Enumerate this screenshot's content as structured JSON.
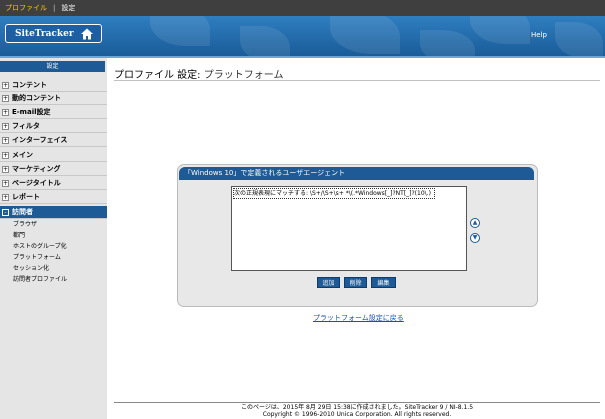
{
  "topnav": {
    "profile": "プロファイル",
    "settings": "設定",
    "separator": "|"
  },
  "header": {
    "logo": "SiteTracker",
    "help": "Help"
  },
  "sidebar": {
    "title": "設定",
    "items": [
      {
        "label": "コンテント"
      },
      {
        "label": "動的コンテント"
      },
      {
        "label": "E-mail設定"
      },
      {
        "label": "フィルタ"
      },
      {
        "label": "インターフェイス"
      },
      {
        "label": "メイン"
      },
      {
        "label": "マーケティング"
      },
      {
        "label": "ページタイトル"
      },
      {
        "label": "レポート"
      },
      {
        "label": "訪問者"
      }
    ],
    "subitems": [
      "ブラウザ",
      "都門",
      "ホストのグループ化",
      "プラットフォーム",
      "セッション化",
      "訪問者プロファイル"
    ]
  },
  "main": {
    "title_prefix": "プロファイル 設定:",
    "title_page": "プラットフォーム",
    "panel_title": "「Windows 10」で定義されるユーザエージェント",
    "list_rows": [
      "次の正規表現にマッチする: \\S+/\\S+\\s+ *\\(.*Windows[_]?NT[_]?(10\\.)"
    ],
    "buttons": {
      "add": "追加",
      "delete": "削除",
      "edit": "編集"
    },
    "back_link": "プラットフォーム設定に戻る"
  },
  "footer": {
    "line1": "このページは、2015年 8月 29日 15:38に作成されました。SiteTracker 9 / NI-8.1.5",
    "line2": "Copyright © 1996-2010 Unica Corporation. All rights reserved."
  }
}
